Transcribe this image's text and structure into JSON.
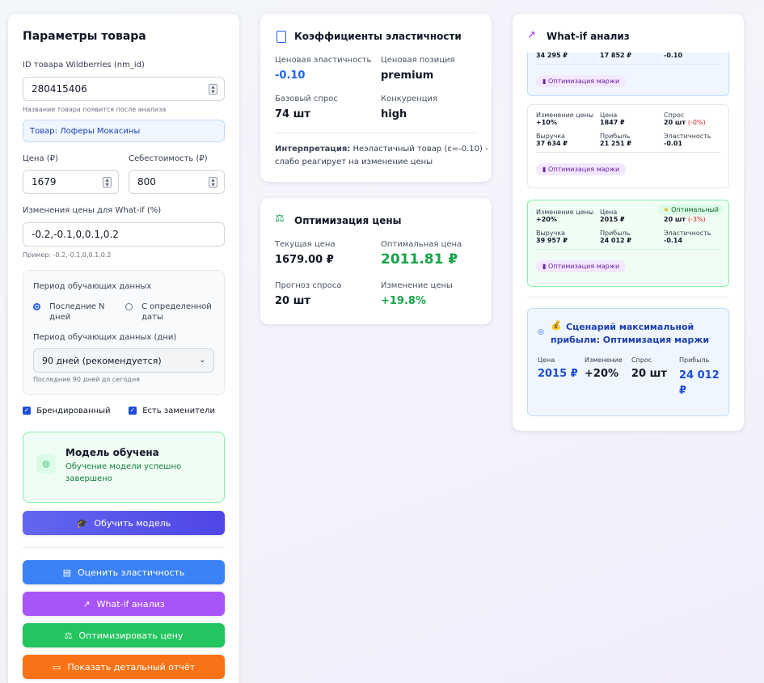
{
  "params": {
    "title": "Параметры товара",
    "id_label": "ID товара Wildberries (nm_id)",
    "id_value": "280415406",
    "name_hint": "Название товара появится после анализа",
    "product_name": "Товар: Лоферы Мокасины",
    "price_label": "Цена (₽)",
    "price_value": "1679",
    "cost_label": "Себестоимость (₽)",
    "cost_value": "800",
    "changes_label": "Изменения цены для What-if (%)",
    "changes_value": "-0.2,-0.1,0,0.1,0.2",
    "changes_example": "Пример: -0.2,-0.1,0,0.1,0.2",
    "period": {
      "title": "Период обучающих данных",
      "option1_line1": "Последние N",
      "option1_line2": "дней",
      "option2_line1": "С определенной",
      "option2_line2": "даты",
      "days_label": "Период обучающих данных (дни)",
      "days_value": "90 дней (рекомендуется)",
      "days_hint": "Последние 90 дней до сегодня"
    },
    "branded": "Брендированный",
    "substitutes": "Есть заменители",
    "model": {
      "title": "Модель обучена",
      "msg_line1": "Обучение модели успешно",
      "msg_line2": "завершено"
    },
    "buttons": {
      "train": "Обучить модель",
      "elasticity": "Оценить эластичность",
      "whatif": "What-if анализ",
      "optimize": "Оптимизировать цену",
      "report": "Показать детальный отчёт"
    }
  },
  "elasticity": {
    "title": "Коэффициенты эластичности",
    "price_elasticity_label": "Ценовая эластичность",
    "price_elasticity_value": "-0.10",
    "position_label": "Ценовая позиция",
    "position_value": "premium",
    "base_demand_label": "Базовый спрос",
    "base_demand_value": "74 шт",
    "competition_label": "Конкуренция",
    "competition_value": "high",
    "interp_label": "Интерпретация:",
    "interp_line1": "Неэластичный товар (ε=-0.10) -",
    "interp_line2": "слабо реагирует на изменение цены"
  },
  "optimization": {
    "title": "Оптимизация цены",
    "current_label": "Текущая цена",
    "current_value": "1679.00 ₽",
    "optimal_label": "Оптимальная цена",
    "optimal_value": "2011.81 ₽",
    "demand_label": "Прогноз спроса",
    "demand_value": "20 шт",
    "change_label": "Изменение цены",
    "change_value": "+19.8%"
  },
  "whatif": {
    "title": "What-if анализ",
    "top_partial": {
      "c1": "34 295 ₽",
      "c2": "17 852 ₽",
      "c3": "-0.10",
      "pill": "Оптимизация маржи"
    },
    "labels": {
      "change": "Изменение цены",
      "price": "Цена",
      "demand": "Спрос",
      "revenue": "Выручка",
      "profit": "Прибыль",
      "elasticity": "Эластичность"
    },
    "scenario_10": {
      "change": "+10%",
      "price": "1847 ₽",
      "demand": "20 шт",
      "demand_delta": "(-0%)",
      "revenue": "37 634 ₽",
      "profit": "21 251 ₽",
      "elasticity": "-0.01",
      "pill": "Оптимизация маржи"
    },
    "scenario_20": {
      "badge": "Оптимальный",
      "change": "+20%",
      "price": "2015 ₽",
      "demand": "20 шт",
      "demand_delta": "(-3%)",
      "revenue": "39 957 ₽",
      "profit": "24 012 ₽",
      "elasticity": "-0.14",
      "pill": "Оптимизация маржи"
    },
    "best": {
      "title_line1": "Сценарий максимальной",
      "title_line2": "прибыли: Оптимизация маржи",
      "price_label": "Цена",
      "price_value": "2015 ₽",
      "change_label": "Изменение",
      "change_value": "+20%",
      "demand_label": "Спрос",
      "demand_value": "20 шт",
      "profit_label": "Прибыль",
      "profit_line1": "24 012",
      "profit_line2": "₽"
    }
  },
  "colors": {
    "accent_blue": "#2563eb",
    "positive_green": "#16a34a",
    "negative_red": "#dc2626",
    "train_gradient": [
      "#6366f1",
      "#4f46e5"
    ],
    "elasticity_btn": "#3b82f6",
    "whatif_btn": "#a855f7",
    "optimize_btn": "#22c55e",
    "report_btn": "#f97316"
  }
}
